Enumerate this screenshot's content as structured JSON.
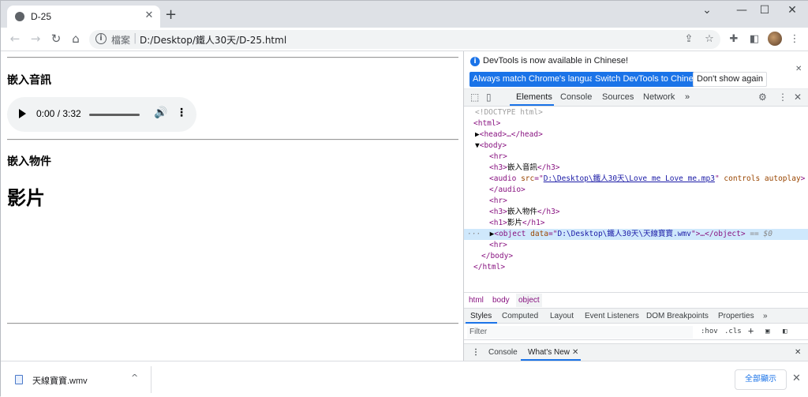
{
  "browser": {
    "tab_title": "D-25",
    "tab_close": "✕",
    "new_tab": "+",
    "window_controls": {
      "minimize": "—",
      "maximize": "☐",
      "close": "✕",
      "menu": "⌄"
    },
    "nav": {
      "back": "←",
      "forward": "→",
      "reload": "↻",
      "home": "⌂"
    },
    "omnibox": {
      "scheme_label": "檔案",
      "url": "D:/Desktop/鐵人30天/D-25.html"
    },
    "toolbar_icons": [
      "share-icon",
      "star-icon",
      "extensions-icon",
      "sidepanel-icon",
      "avatar",
      "menu-icon"
    ]
  },
  "page": {
    "h3_audio": "嵌入音訊",
    "audio": {
      "time": "0:00 / 3:32",
      "progress": 0
    },
    "h3_object": "嵌入物件",
    "h1_video": "影片"
  },
  "devtools": {
    "infobar": {
      "message": "DevTools is now available in Chinese!",
      "btn_match": "Always match Chrome's language",
      "btn_switch": "Switch DevTools to Chinese",
      "btn_dont": "Don't show again",
      "close": "✕"
    },
    "tabs": [
      "Elements",
      "Console",
      "Sources",
      "Network",
      "»"
    ],
    "dom": {
      "doctype": "<!DOCTYPE html>",
      "html_open": "<html>",
      "head": "<head>…</head>",
      "body_open": "<body>",
      "hr": "<hr>",
      "h3_a_open": "<h3>",
      "h3_a_text": "嵌入音訊",
      "h3_close": "</h3>",
      "audio_open": "<audio",
      "audio_src_attr": "src",
      "audio_src_val": "D:\\Desktop\\鐵人30天\\Love me Love me.mp3",
      "audio_controls": "controls",
      "audio_autoplay": "autoplay",
      "audio_close": "</audio>",
      "h3_b_text": "嵌入物件",
      "h1_open": "<h1>",
      "h1_text": "影片",
      "h1_close": "</h1>",
      "object_open": "<object",
      "object_data_attr": "data",
      "object_data_val": "D:\\Desktop\\鐵人30天\\天線寶寶.wmv",
      "object_rest": ">…</object>",
      "selected_marker": "== $0",
      "body_close": "</body>",
      "html_close": "</html>",
      "dots": "···"
    },
    "breadcrumbs": [
      "html",
      "body",
      "object"
    ],
    "sub_tabs": [
      "Styles",
      "Computed",
      "Layout",
      "Event Listeners",
      "DOM Breakpoints",
      "Properties",
      "»"
    ],
    "filter_placeholder": "Filter",
    "filter_options": {
      "hov": ":hov",
      "cls": ".cls",
      "plus": "+"
    },
    "drawer": {
      "console": "Console",
      "whats_new": "What's New",
      "close_tab": "✕",
      "close": "✕",
      "menu": "⋮"
    }
  },
  "downloads": {
    "file": "天線寶寶.wmv",
    "chevron": "^",
    "show_all": "全部顯示",
    "close": "✕"
  },
  "colors": {
    "accent": "#1a73e8",
    "tag": "#881280",
    "attr": "#994500",
    "value": "#1a1aa6"
  }
}
